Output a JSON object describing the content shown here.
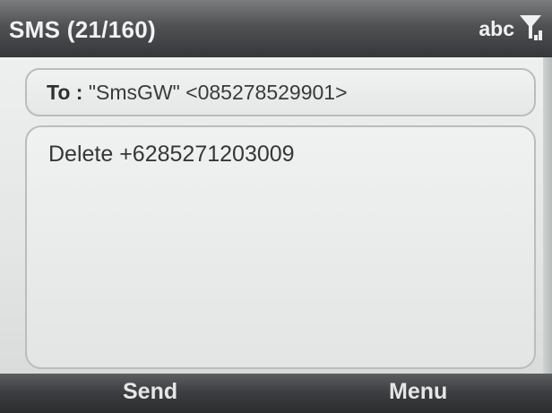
{
  "titlebar": {
    "title": "SMS (21/160)",
    "input_mode": "abc",
    "signal_icon": "signal-antenna-icon"
  },
  "compose": {
    "to_label": "To :",
    "to_value": " \"SmsGW\" <085278529901>",
    "message": "Delete +6285271203009"
  },
  "softkeys": {
    "left": "Send",
    "right": "Menu"
  },
  "colors": {
    "titlebar": "#4f5153",
    "body": "#e3e6e5",
    "text": "#363636"
  }
}
